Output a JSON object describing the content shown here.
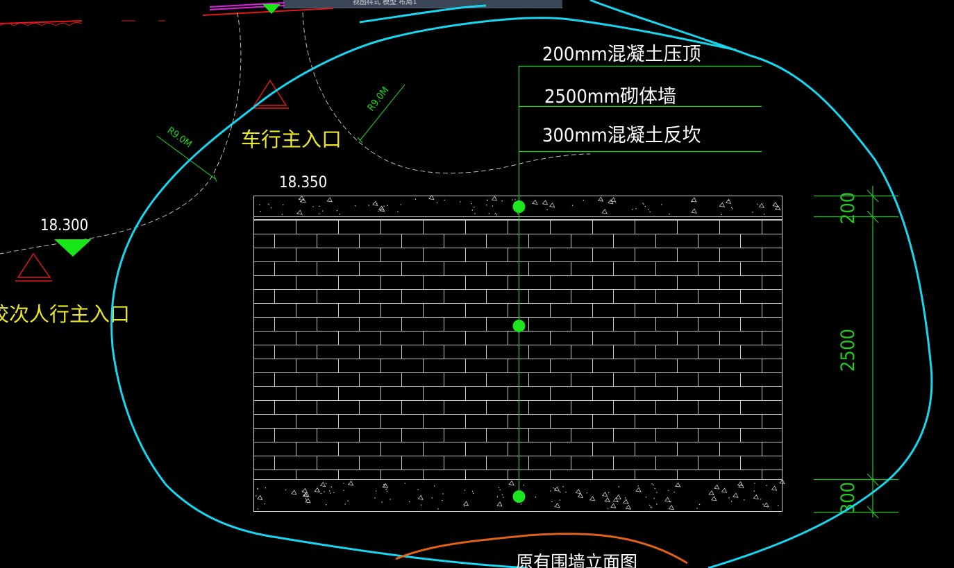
{
  "toolbar_caption": "视图样式  模型  布局1",
  "callouts": {
    "cap": "200mm混凝土压顶",
    "wall": "2500mm砌体墙",
    "base": "300mm混凝土反坎"
  },
  "elevations": {
    "wall_top": "18.350",
    "ground_left": "18.300"
  },
  "entrances": {
    "vehicle": "车行主入口",
    "pedestrian": "校次人行主入口"
  },
  "radius_labels": [
    "R9.0M",
    "R9.0M"
  ],
  "dimensions": {
    "top": "200",
    "middle": "2500",
    "bottom": "300"
  },
  "drawing_title": "原有围墙立面图",
  "colors": {
    "background": "#000000",
    "cloud": "#19d6f0",
    "annotation": "#1ed81e",
    "dimension": "#22c922",
    "text": "#ffffff",
    "entrance_text": "#e8e62a",
    "red_marker": "#e01a1a",
    "orange_arc": "#e0621a",
    "hatch": "#d8d8d8"
  }
}
